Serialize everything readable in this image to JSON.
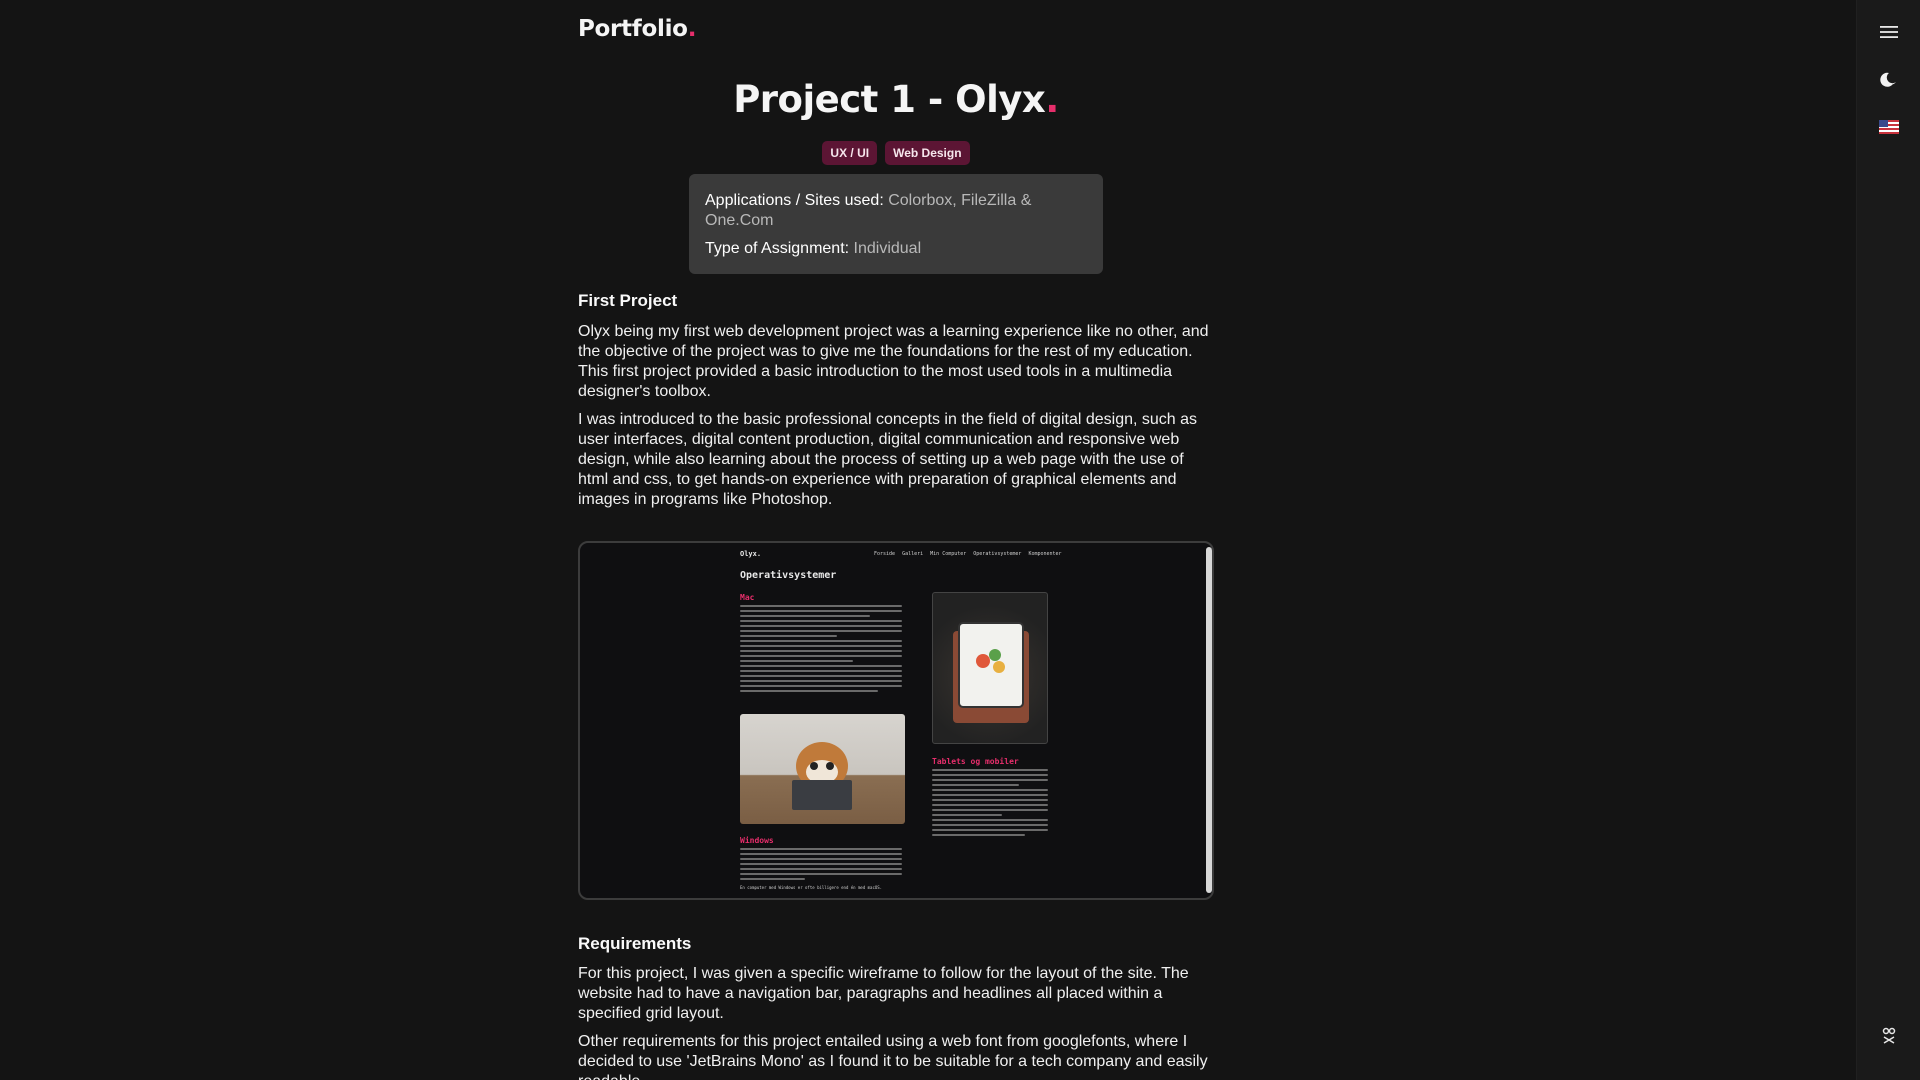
{
  "header": {
    "logo_text": "Portfolio",
    "logo_dot": "."
  },
  "rail": {
    "menu_icon": "menu-icon",
    "theme_icon": "moon-icon",
    "language_icon": "us-flag-icon",
    "bottom_icon": "accessibility-icon"
  },
  "project": {
    "title": "Project 1 - Olyx",
    "title_dot": ".",
    "tags": [
      "UX / UI",
      "Web Design"
    ],
    "info": {
      "apps_label": "Applications / Sites used",
      "apps_value": "Colorbox, FileZilla & One.Com",
      "type_label": "Type of Assignment",
      "type_value": "Individual"
    }
  },
  "sections": {
    "first": {
      "heading": "First Project",
      "p1": "Olyx being my first web development project was a learning experience like no other, and the objective of the project was to give me the foundations for the rest of my education. This first project provided a basic introduction to the most used tools in a multimedia designer's toolbox.",
      "p2": "I was introduced to the basic professional concepts in the field of digital design, such as user interfaces, digital content production, digital communication and responsive web design, while also learning about the process of setting up a web page with the use of html and css, to get hands-on experience with preparation of graphical elements and images in programs like Photoshop."
    },
    "requirements": {
      "heading": "Requirements",
      "p1": "For this project, I was given a specific wireframe to follow for the layout of the site. The website had to have a navigation bar, paragraphs and headlines all placed within a specified grid layout.",
      "p2": "Other requirements for this project entailed using a web font from googlefonts, where I decided to use 'JetBrains Mono' as I found it to be suitable for a tech company and easily readable."
    }
  },
  "screenshot": {
    "logo": "Olyx.",
    "nav": [
      "Forside",
      "Galleri",
      "Min Computer",
      "Operativsystemer",
      "Komponenter"
    ],
    "heading": "Operativsystemer",
    "sub_mac": "Mac",
    "sub_tablets": "Tablets og mobiler",
    "sub_windows": "Windows",
    "footer_line": "En computer med Windows er ofte billigere end én med macOS."
  }
}
